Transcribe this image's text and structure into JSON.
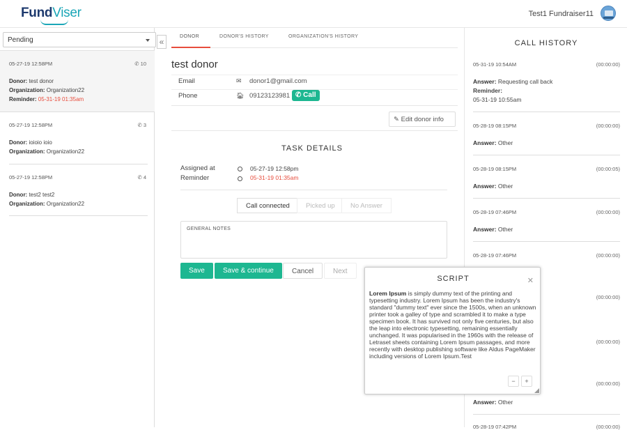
{
  "header": {
    "logo_left": "Fund",
    "logo_right": "Viser",
    "user_name": "Test1 Fundraiser11"
  },
  "sidebar": {
    "filter_value": "Pending",
    "collapse_icon": "double-chevron-left-icon",
    "tasks": [
      {
        "date": "05-27-19 12:58PM",
        "calls": "10",
        "donor_label": "Donor:",
        "donor": "test donor",
        "org_label": "Organization:",
        "organization": "Organization22",
        "reminder_label": "Reminder:",
        "reminder": "05-31-19 01:35am"
      },
      {
        "date": "05-27-19 12:58PM",
        "calls": "3",
        "donor_label": "Donor:",
        "donor": "ioioio ioio",
        "org_label": "Organization:",
        "organization": "Organization22"
      },
      {
        "date": "05-27-19 12:58PM",
        "calls": "4",
        "donor_label": "Donor:",
        "donor": "test2 test2",
        "org_label": "Organization:",
        "organization": "Organization22"
      }
    ]
  },
  "main": {
    "tabs": [
      {
        "label": "DONOR"
      },
      {
        "label": "DONOR'S HISTORY"
      },
      {
        "label": "ORGANIZATION'S HISTORY"
      }
    ],
    "donor_name": "test donor",
    "email_label": "Email",
    "email": "donor1@gmail.com",
    "phone_label": "Phone",
    "phone": "09123123981",
    "call_button": "Call",
    "edit_button": "Edit donor info",
    "task_details_title": "TASK DETAILS",
    "assigned_label": "Assigned at",
    "assigned_value": "05-27-19 12:58pm",
    "reminder_label": "Reminder",
    "reminder_value": "05-31-19 01:35am",
    "status_buttons": [
      "Call connected",
      "Picked up",
      "No Answer"
    ],
    "notes_placeholder": "GENERAL NOTES",
    "save": "Save",
    "save_continue": "Save & continue",
    "cancel": "Cancel",
    "next": "Next"
  },
  "call_history": {
    "title": "CALL HISTORY",
    "items": [
      {
        "date": "05-31-19 10:54AM",
        "duration": "(00:00:00)",
        "answer_label": "Answer:",
        "answer": "Requesting call back",
        "reminder_label": "Reminder:",
        "reminder": "05-31-19 10:55am"
      },
      {
        "date": "05-28-19 08:15PM",
        "duration": "(00:00:00)",
        "answer_label": "Answer:",
        "answer": "Other"
      },
      {
        "date": "05-28-19 08:15PM",
        "duration": "(00:00:05)",
        "answer_label": "Answer:",
        "answer": "Other"
      },
      {
        "date": "05-28-19 07:46PM",
        "duration": "(00:00:00)",
        "answer_label": "Answer:",
        "answer": "Other"
      },
      {
        "date": "05-28-19 07:46PM",
        "duration": "(00:00:00)"
      },
      {
        "date": "",
        "duration": "(00:00:00)"
      },
      {
        "date": "",
        "duration": "(00:00:00)"
      },
      {
        "date": "",
        "duration": "(00:00:00)",
        "answer_label": "Answer:",
        "answer": "Other"
      },
      {
        "date": "05-28-19 07:42PM",
        "duration": "(00:00:00)"
      }
    ]
  },
  "script": {
    "title": "SCRIPT",
    "lead": "Lorem Ipsum",
    "text": " is simply dummy text of the printing and typesetting industry. Lorem Ipsum has been the industry's standard \"dummy text\" ever since the 1500s, when an unknown printer took a galley of type and scrambled it to make a type specimen book. It has survived not only five centuries, but also the leap into electronic typesetting, remaining essentially unchanged. It was popularised in the 1960s with the release of Letraset sheets containing Lorem Ipsum passages, and more recently with desktop publishing software like Aldus PageMaker including versions of Lorem Ipsum.Test"
  }
}
